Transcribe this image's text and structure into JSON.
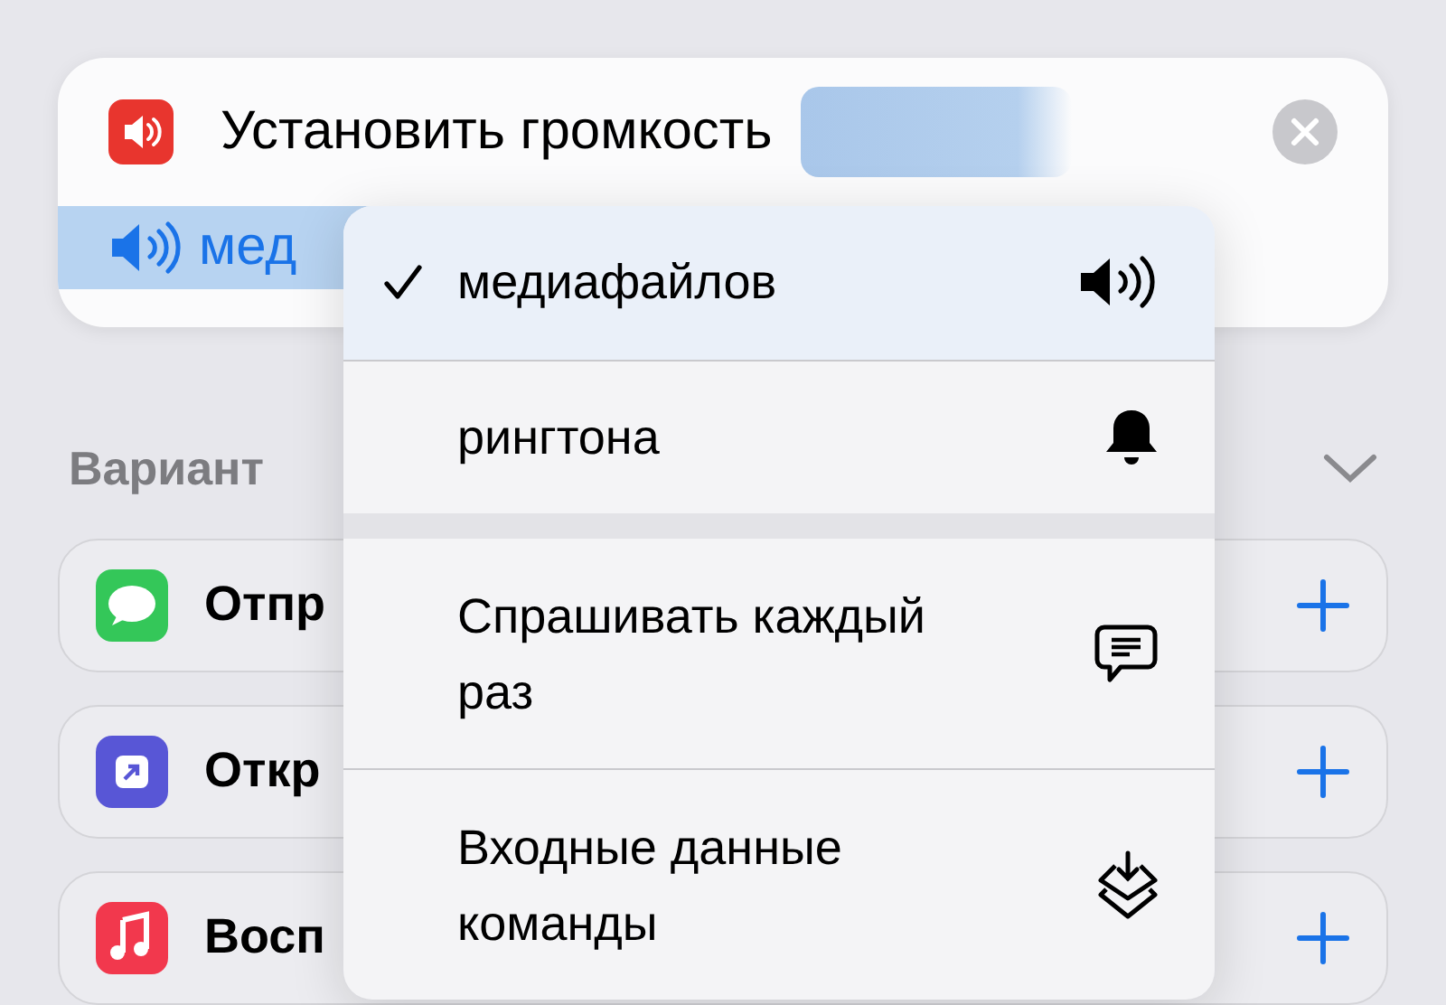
{
  "action": {
    "title": "Установить громкость",
    "parameter": "мед",
    "highlighted": true
  },
  "suggestions": {
    "heading": "Вариант",
    "expanded": true,
    "items": [
      {
        "label": "Отпр",
        "kind": "messages"
      },
      {
        "label": "Откр",
        "kind": "open"
      },
      {
        "label": "Восп",
        "kind": "music"
      }
    ]
  },
  "menu": {
    "sections": [
      [
        {
          "label": "медиафайлов",
          "kind": "speaker",
          "selected": true
        },
        {
          "label": "рингтона",
          "kind": "bell",
          "selected": false
        }
      ],
      [
        {
          "label": "Спрашивать каждый раз",
          "kind": "chat",
          "selected": false
        },
        {
          "label": "Входные данные команды",
          "kind": "layers",
          "selected": false
        }
      ]
    ]
  }
}
